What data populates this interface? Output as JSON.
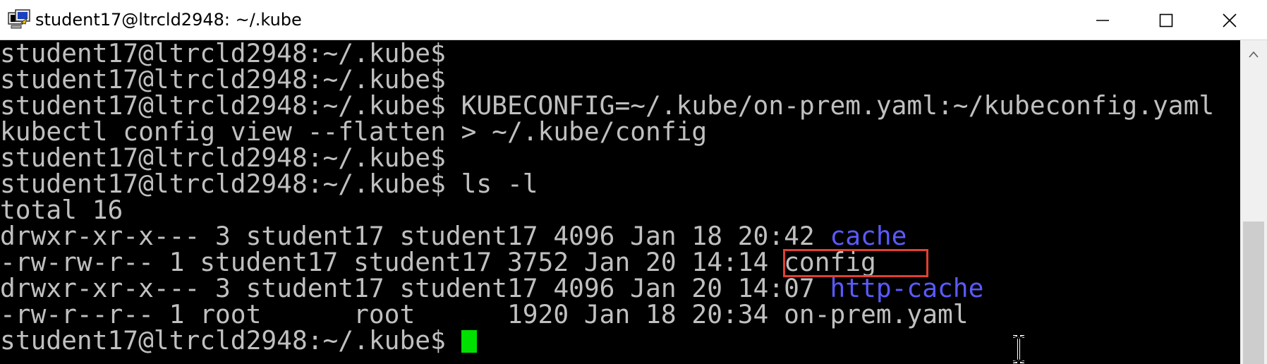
{
  "window": {
    "title": "student17@ltrcld2948: ~/.kube",
    "icons": {
      "app": "putty-terminal-icon",
      "minimize": "minimize-icon",
      "maximize": "maximize-icon",
      "close": "close-icon"
    }
  },
  "terminal": {
    "lines": [
      {
        "text": "student17@ltrcld2948:~/.kube$"
      },
      {
        "text": "student17@ltrcld2948:~/.kube$"
      },
      {
        "text": "student17@ltrcld2948:~/.kube$ KUBECONFIG=~/.kube/on-prem.yaml:~/kubeconfig.yaml"
      },
      {
        "text": "kubectl config view --flatten > ~/.kube/config"
      },
      {
        "text": "student17@ltrcld2948:~/.kube$"
      },
      {
        "text": "student17@ltrcld2948:~/.kube$ ls -l"
      },
      {
        "text": "total 16"
      },
      {
        "prefix": "drwxr-xr-x--- 3 student17 student17 4096 Jan 18 20:42 ",
        "name": "cache"
      },
      {
        "prefix": "-rw-rw-r-- 1 student17 student17 3752 Jan 20 14:14 ",
        "name": "config"
      },
      {
        "prefix": "drwxr-xr-x--- 3 student17 student17 4096 Jan 20 14:07 ",
        "name": "http-cache"
      },
      {
        "prefix": "-rw-r--r-- 1 root      root      1920 Jan 18 20:34 ",
        "name": "on-prem.yaml"
      },
      {
        "prompt": "student17@ltrcld2948:~/.kube$ "
      }
    ],
    "colors": {
      "text": "#c0c0c0",
      "directory": "#5a5aff",
      "cursor": "#00e000",
      "highlight": "#e04030"
    }
  },
  "scrollbar": {
    "arrow_icon": "scroll-up-arrow-icon"
  }
}
